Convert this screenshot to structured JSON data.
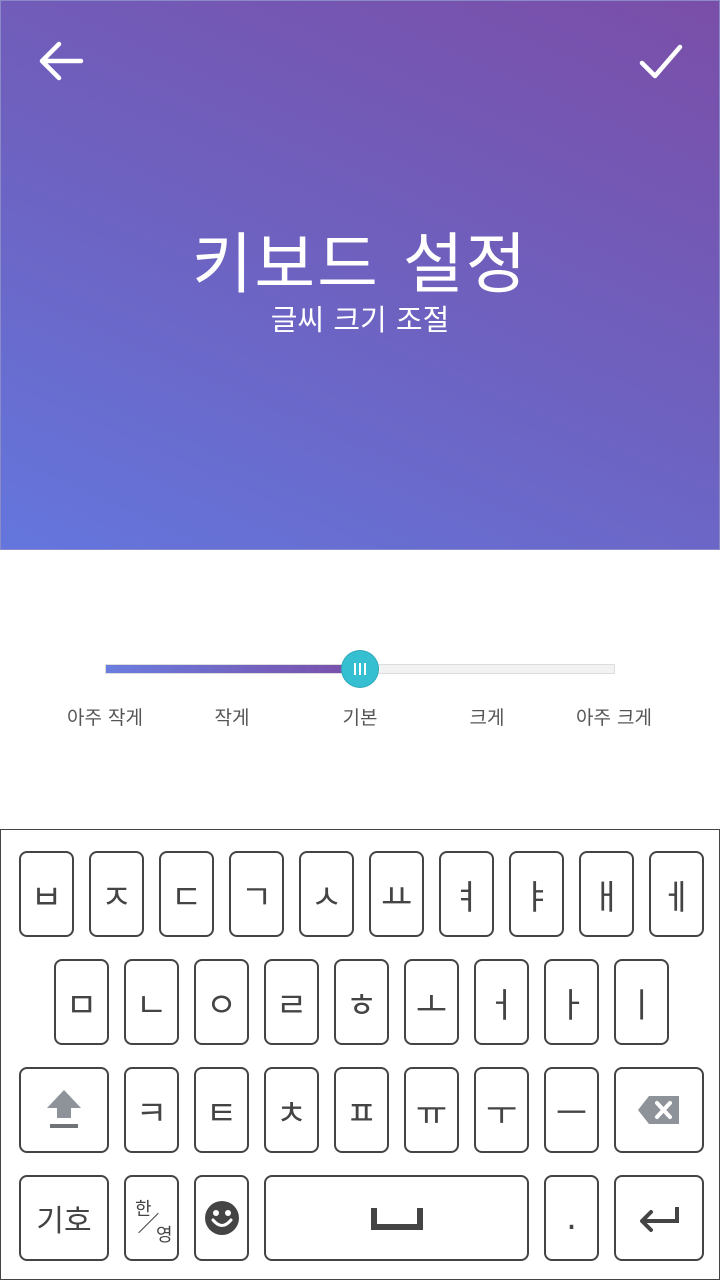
{
  "header": {
    "back_icon": "arrow-left-icon",
    "confirm_icon": "check-icon",
    "title": "키보드 설정",
    "subtitle": "글씨 크기 조절"
  },
  "font_size_slider": {
    "selected_index": 2,
    "progress": 0.5,
    "labels": [
      "아주 작게",
      "작게",
      "기본",
      "크게",
      "아주 크게"
    ]
  },
  "keyboard": {
    "row1": [
      "ㅂ",
      "ㅈ",
      "ㄷ",
      "ㄱ",
      "ㅅ",
      "ㅛ",
      "ㅕ",
      "ㅑ",
      "ㅐ",
      "ㅔ"
    ],
    "row2": [
      "ㅁ",
      "ㄴ",
      "ㅇ",
      "ㄹ",
      "ㅎ",
      "ㅗ",
      "ㅓ",
      "ㅏ",
      "ㅣ"
    ],
    "row3": [
      "ㅋ",
      "ㅌ",
      "ㅊ",
      "ㅍ",
      "ㅠ",
      "ㅜ",
      "ㅡ"
    ],
    "shift_icon": "shift-icon",
    "backspace_icon": "backspace-icon",
    "symbols_label": "기호",
    "lang_primary": "한",
    "lang_secondary": "영",
    "emoji_icon": "smiley-icon",
    "space_icon": "space-bar-icon",
    "period_label": ".",
    "enter_icon": "enter-icon"
  },
  "colors": {
    "gradient_start": "#6476dd",
    "gradient_end": "#7a4ea8",
    "slider_thumb": "#36bfd0",
    "key_border": "#444444"
  }
}
